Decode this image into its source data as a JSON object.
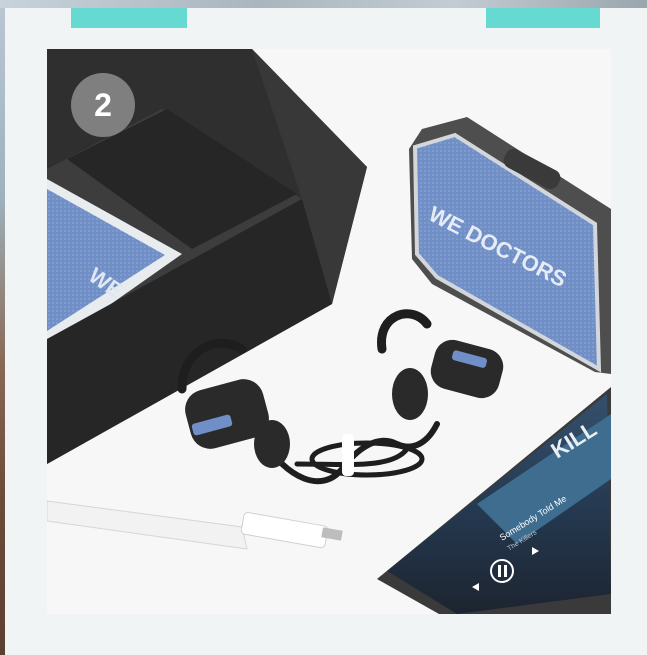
{
  "step": {
    "number": "2"
  },
  "colors": {
    "tape": "#66d9d1",
    "card": "#f1f4f5",
    "badge": "#969696"
  },
  "product": {
    "speaker_text": "WE DOCTORS",
    "box_text": "WE",
    "phone": {
      "song_title": "Somebody Told Me",
      "artist": "The Killers",
      "banner_text": "KILL"
    }
  }
}
